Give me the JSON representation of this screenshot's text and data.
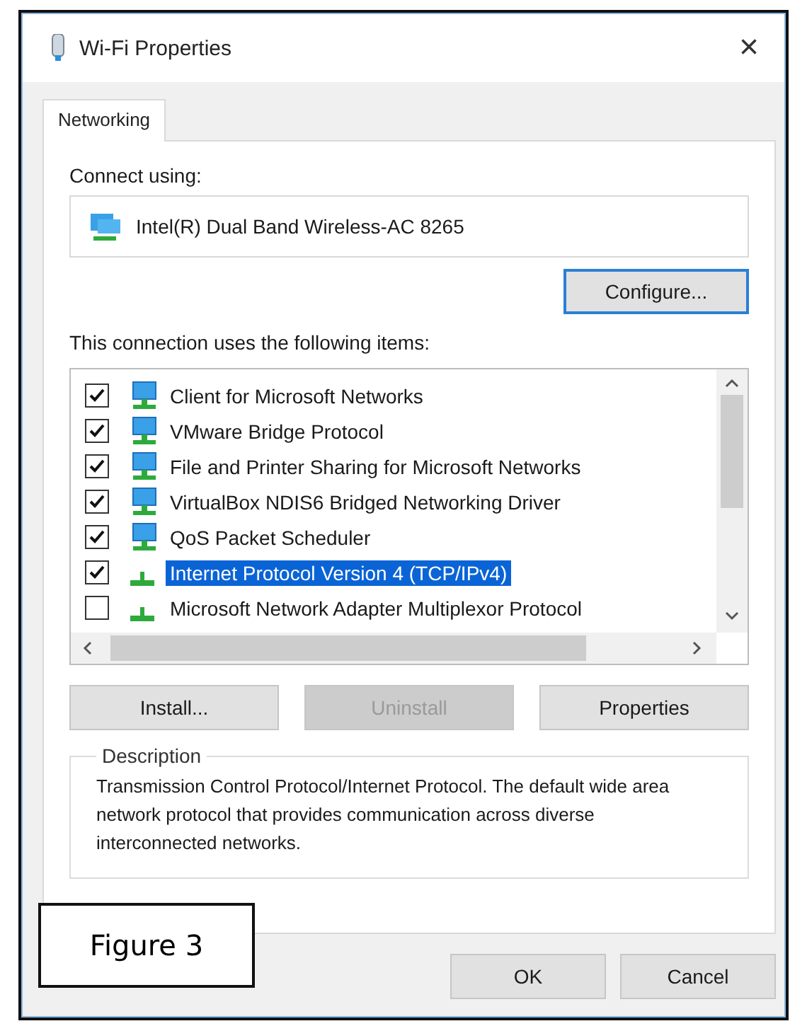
{
  "window": {
    "title": "Wi-Fi Properties",
    "close": "×"
  },
  "tabs": [
    {
      "label": "Networking",
      "selected": true
    }
  ],
  "connect_using": {
    "label": "Connect using:",
    "adapter": "Intel(R) Dual Band Wireless-AC 8265"
  },
  "configure_button": {
    "label": "Configure...",
    "focused": true
  },
  "items_label": "This connection uses the following items:",
  "items": [
    {
      "label": "Client for Microsoft Networks",
      "checked": true,
      "selected": false,
      "kind": "network"
    },
    {
      "label": "VMware Bridge Protocol",
      "checked": true,
      "selected": false,
      "kind": "network"
    },
    {
      "label": "File and Printer Sharing for Microsoft Networks",
      "checked": true,
      "selected": false,
      "kind": "network"
    },
    {
      "label": "VirtualBox NDIS6 Bridged Networking Driver",
      "checked": true,
      "selected": false,
      "kind": "network"
    },
    {
      "label": "QoS Packet Scheduler",
      "checked": true,
      "selected": false,
      "kind": "network"
    },
    {
      "label": "Internet Protocol Version 4 (TCP/IPv4)",
      "checked": true,
      "selected": true,
      "kind": "protocol"
    },
    {
      "label": "Microsoft Network Adapter Multiplexor Protocol",
      "checked": false,
      "selected": false,
      "kind": "protocol"
    }
  ],
  "item_buttons": [
    {
      "label": "Install...",
      "disabled": false
    },
    {
      "label": "Uninstall",
      "disabled": true
    },
    {
      "label": "Properties",
      "disabled": false
    }
  ],
  "description": {
    "title": "Description",
    "text": "Transmission Control Protocol/Internet Protocol. The default wide area network protocol that provides communication across diverse interconnected networks."
  },
  "dialog_buttons": [
    {
      "label": "OK"
    },
    {
      "label": "Cancel"
    }
  ],
  "caption": "Figure 3"
}
